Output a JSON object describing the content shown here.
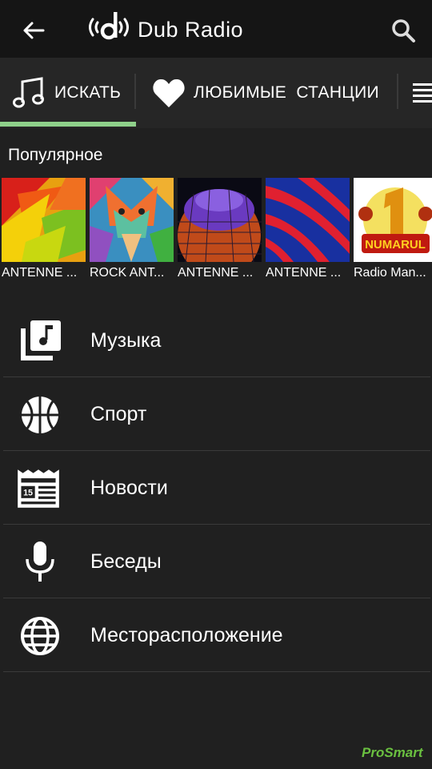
{
  "app": {
    "title": "Dub Radio"
  },
  "tabs": [
    {
      "label": "ИСКАТЬ",
      "icon": "music-note-icon"
    },
    {
      "label": "ЛЮБИМЫЕ  СТАНЦИИ",
      "icon": "heart-icon"
    },
    {
      "label": "",
      "icon": "list-icon"
    }
  ],
  "popular": {
    "title": "Популярное",
    "stations": [
      {
        "label": "ANTENNE ..."
      },
      {
        "label": "ROCK ANT..."
      },
      {
        "label": "ANTENNE ..."
      },
      {
        "label": "ANTENNE ..."
      },
      {
        "label": "Radio Man..."
      }
    ]
  },
  "categories": [
    {
      "label": "Музыка",
      "icon": "music-library-icon"
    },
    {
      "label": "Спорт",
      "icon": "basketball-icon"
    },
    {
      "label": "Новости",
      "icon": "newspaper-icon"
    },
    {
      "label": "Беседы",
      "icon": "microphone-icon"
    },
    {
      "label": "Месторасположение",
      "icon": "globe-icon"
    }
  ],
  "watermark": "ProSmart",
  "colors": {
    "accent": "#8fd08a",
    "background": "#202020",
    "appbar": "#151515"
  }
}
